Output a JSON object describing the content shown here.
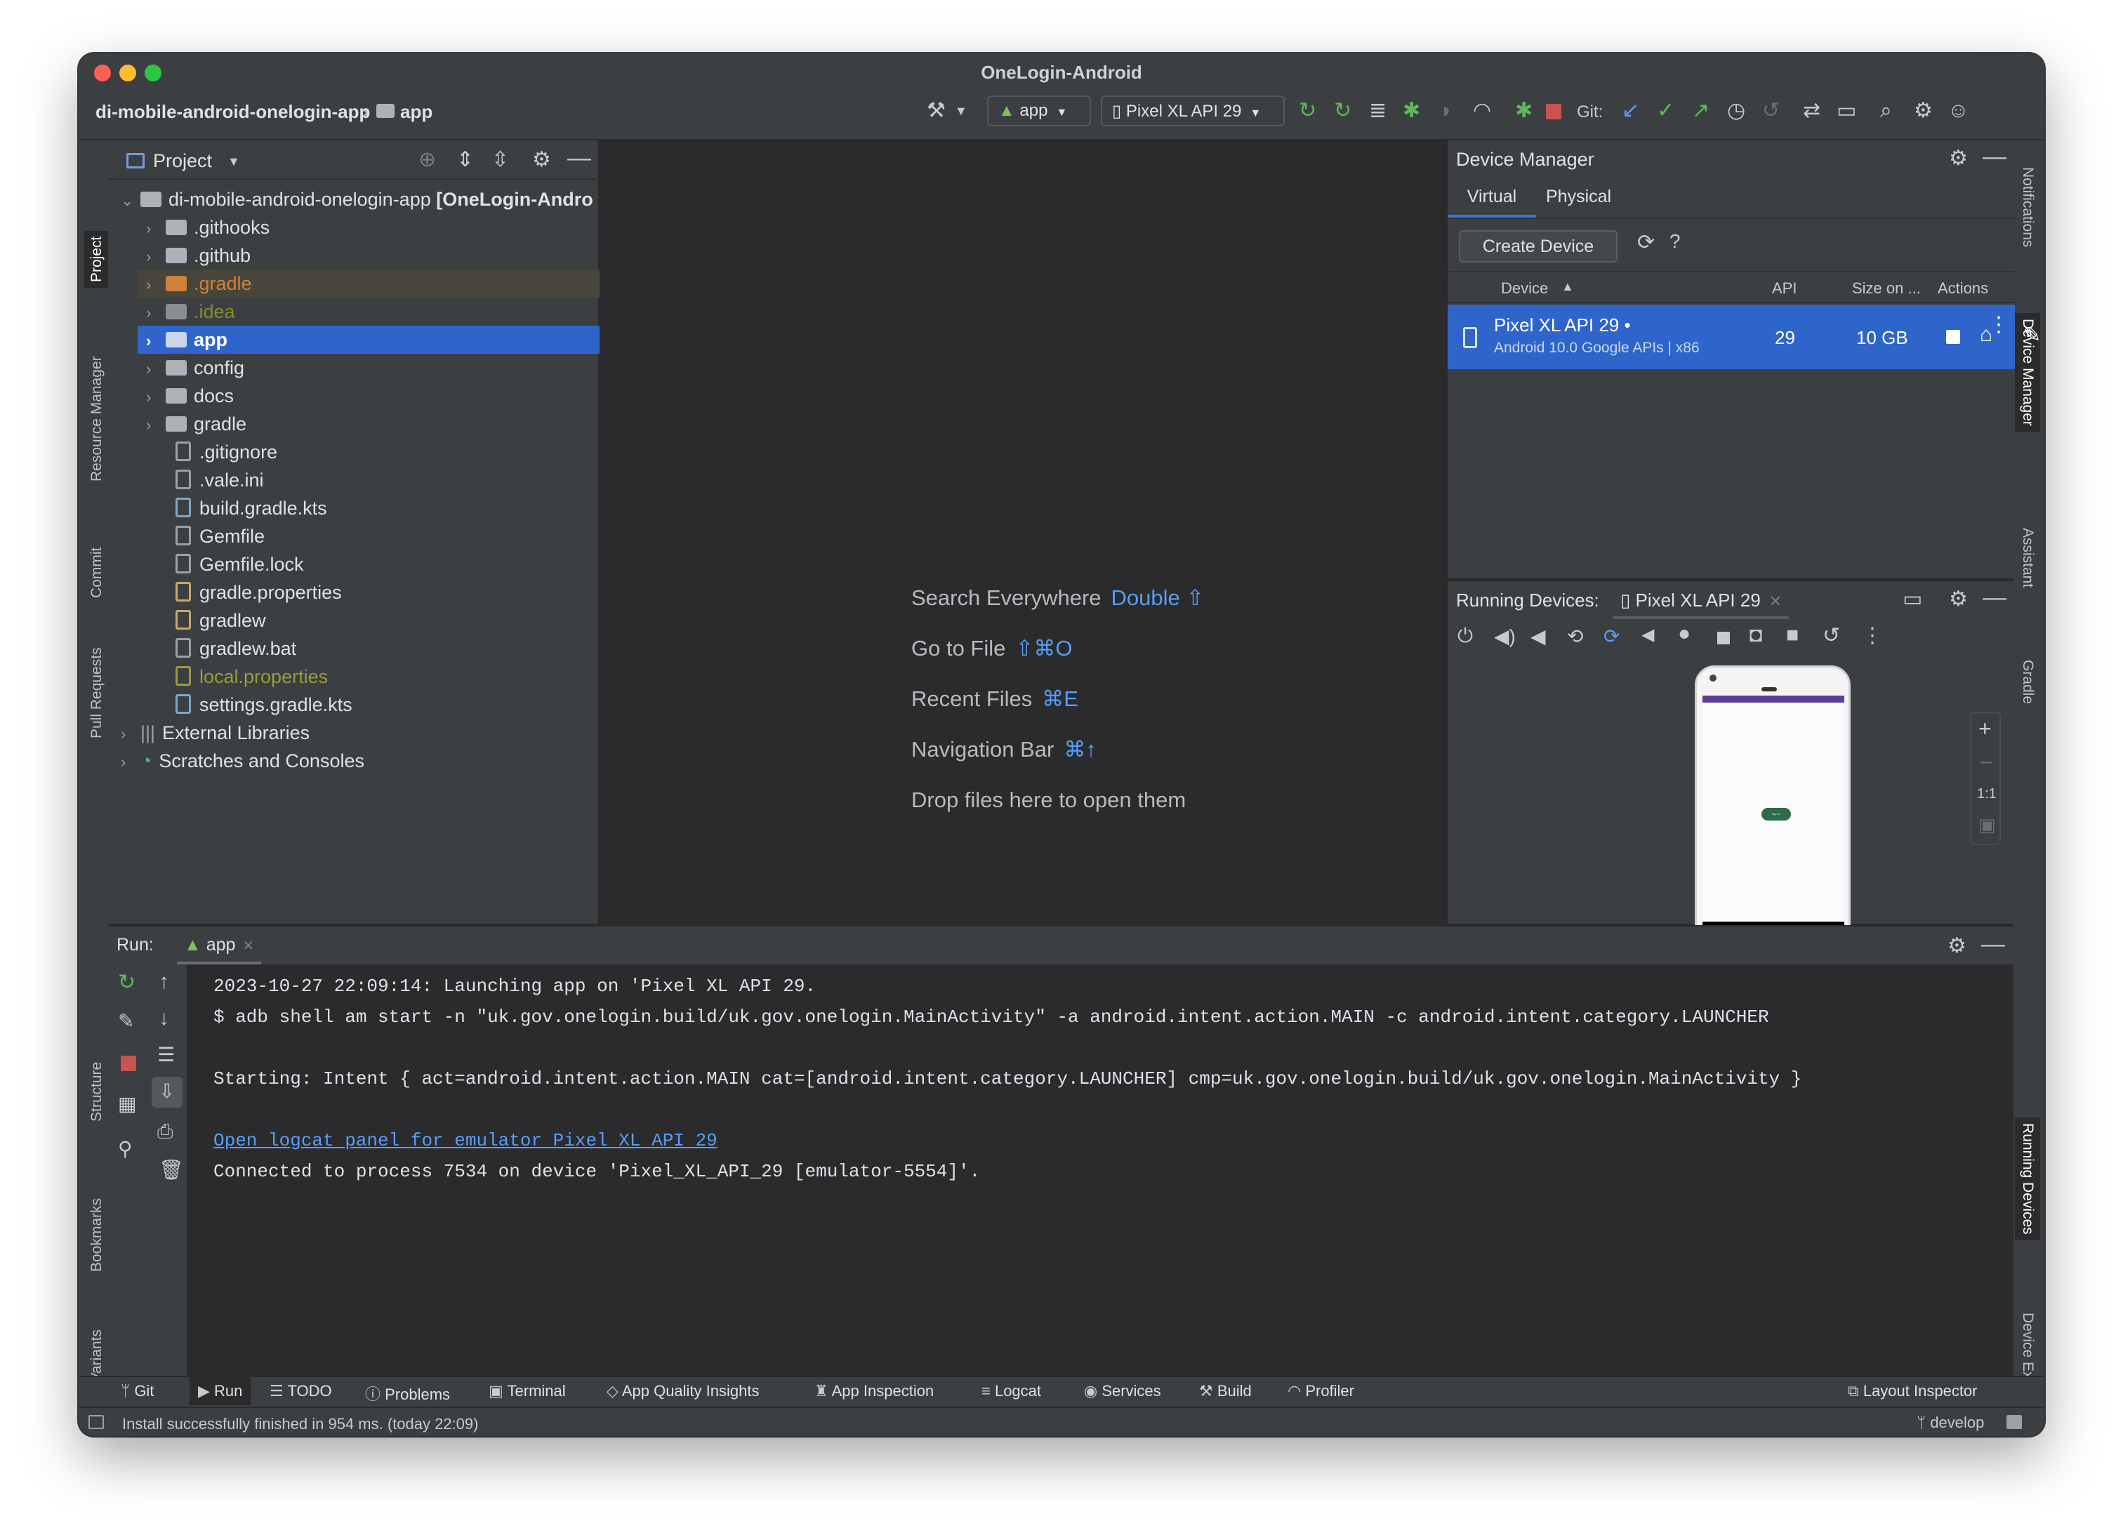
{
  "window": {
    "title": "OneLogin-Android"
  },
  "breadcrumb": {
    "project": "di-mobile-android-onelogin-app",
    "module": "app"
  },
  "toolbar": {
    "run_config": "app",
    "device": "Pixel XL API 29",
    "git_label": "Git:"
  },
  "left_strip": [
    "Project",
    "Resource Manager",
    "Commit",
    "Pull Requests",
    "Structure",
    "Bookmarks",
    "Build Variants"
  ],
  "right_strip": [
    "Notifications",
    "Device Manager",
    "Assistant",
    "Gradle",
    "Running Devices",
    "Device Explorer"
  ],
  "project_panel": {
    "title": "Project",
    "root": {
      "name": "di-mobile-android-onelogin-app",
      "suffix": "[OneLogin-Andro"
    },
    "items": [
      ".githooks",
      ".github",
      ".gradle",
      ".idea",
      "app",
      "config",
      "docs",
      "gradle",
      ".gitignore",
      ".vale.ini",
      "build.gradle.kts",
      "Gemfile",
      "Gemfile.lock",
      "gradle.properties",
      "gradlew",
      "gradlew.bat",
      "local.properties",
      "settings.gradle.kts"
    ],
    "external": "External Libraries",
    "scratches": "Scratches and Consoles"
  },
  "editor_hints": [
    {
      "label": "Search Everywhere",
      "shortcut": "Double ⇧"
    },
    {
      "label": "Go to File",
      "shortcut": "⇧⌘O"
    },
    {
      "label": "Recent Files",
      "shortcut": "⌘E"
    },
    {
      "label": "Navigation Bar",
      "shortcut": "⌘↑"
    },
    {
      "label": "Drop files here to open them",
      "shortcut": ""
    }
  ],
  "device_manager": {
    "title": "Device Manager",
    "tabs": [
      "Virtual",
      "Physical"
    ],
    "create_button": "Create Device",
    "columns": [
      "Device",
      "API",
      "Size on ...",
      "Actions"
    ],
    "device": {
      "name": "Pixel XL API 29",
      "details": "Android 10.0 Google APIs | x86",
      "api": "29",
      "size": "10 GB"
    }
  },
  "running_devices": {
    "title": "Running Devices:",
    "tab": "Pixel XL API 29",
    "zoom": "1:1",
    "device_screen_button": "Sign in"
  },
  "run_panel": {
    "label": "Run:",
    "tab": "app",
    "lines": [
      "2023-10-27 22:09:14: Launching app on 'Pixel XL API 29.",
      "$ adb shell am start -n \"uk.gov.onelogin.build/uk.gov.onelogin.MainActivity\" -a android.intent.action.MAIN -c android.intent.category.LAUNCHER",
      "Starting: Intent { act=android.intent.action.MAIN cat=[android.intent.category.LAUNCHER] cmp=uk.gov.onelogin.build/uk.gov.onelogin.MainActivity }",
      "Open logcat panel for emulator Pixel XL API 29",
      "Connected to process 7534 on device 'Pixel_XL_API_29 [emulator-5554]'."
    ]
  },
  "bottom_tabs": [
    "Git",
    "Run",
    "TODO",
    "Problems",
    "Terminal",
    "App Quality Insights",
    "App Inspection",
    "Logcat",
    "Services",
    "Build",
    "Profiler"
  ],
  "layout_inspector": "Layout Inspector",
  "status": {
    "message": "Install successfully finished in 954 ms. (today 22:09)",
    "branch": "develop"
  },
  "colors": {
    "accent": "#2f65ca",
    "link": "#589df6",
    "gradle_folder": "#d0803b",
    "idea_folder": "#8b8b2c",
    "local_props": "#9b9b3a",
    "device_button": "#2d6b4a"
  }
}
